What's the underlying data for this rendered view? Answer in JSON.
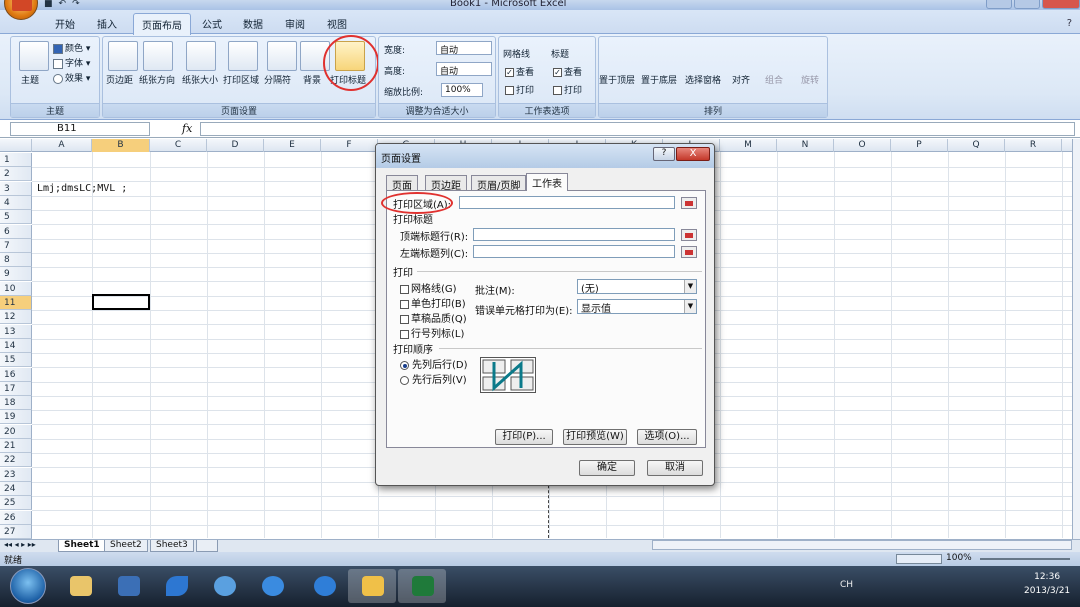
{
  "window": {
    "title": "Book1 - Microsoft Excel",
    "help_icon": "?"
  },
  "tabs": [
    "开始",
    "插入",
    "页面布局",
    "公式",
    "数据",
    "审阅",
    "视图"
  ],
  "ribbon": {
    "theme_group": {
      "label": "主题",
      "themes": "主题",
      "colors": "颜色",
      "fonts": "字体",
      "effects": "效果"
    },
    "page_setup_group": {
      "label": "页面设置",
      "margins": "页边距",
      "orientation": "纸张方向",
      "size": "纸张大小",
      "print_area": "打印区域",
      "breaks": "分隔符",
      "background": "背景",
      "print_titles": "打印标题"
    },
    "scale_group": {
      "label": "调整为合适大小",
      "width": "宽度:",
      "width_value": "自动",
      "height": "高度:",
      "height_value": "自动",
      "scale": "缩放比例:",
      "scale_value": "100%"
    },
    "sheet_options_group": {
      "label": "工作表选项",
      "gridlines": "网格线",
      "headings": "标题",
      "view": "查看",
      "print": "打印"
    },
    "arrange_group": {
      "label": "排列",
      "bring_front": "置于顶层",
      "send_back": "置于底层",
      "selection_pane": "选择窗格",
      "align": "对齐",
      "group": "组合",
      "rotate": "旋转"
    }
  },
  "formula_bar": {
    "name_box": "B11",
    "fx": "fx"
  },
  "columns": [
    "A",
    "B",
    "C",
    "D",
    "E",
    "F",
    "G",
    "H",
    "I",
    "J",
    "K",
    "L",
    "M",
    "N",
    "O",
    "P",
    "Q",
    "R"
  ],
  "rows": [
    "1",
    "2",
    "3",
    "4",
    "5",
    "6",
    "7",
    "8",
    "9",
    "10",
    "11",
    "12",
    "13",
    "14",
    "15",
    "16",
    "17",
    "18",
    "19",
    "20",
    "21",
    "22",
    "23",
    "24",
    "25",
    "26",
    "27"
  ],
  "cells": {
    "A3": "Lmj;dmsLC;MVL ;"
  },
  "sheets": [
    "Sheet1",
    "Sheet2",
    "Sheet3"
  ],
  "status": {
    "ready": "就绪",
    "zoom": "100%"
  },
  "dialog": {
    "title": "页面设置",
    "help": "?",
    "close": "X",
    "tabs": [
      "页面",
      "页边距",
      "页眉/页脚",
      "工作表"
    ],
    "print_area_label": "打印区域(A):",
    "print_titles_label": "打印标题",
    "rows_to_repeat": "顶端标题行(R):",
    "cols_to_repeat": "左端标题列(C):",
    "print_label": "打印",
    "gridlines": "网格线(G)",
    "black_white": "单色打印(B)",
    "draft": "草稿品质(Q)",
    "row_col_headings": "行号列标(L)",
    "comments_label": "批注(M):",
    "comments_value": "(无)",
    "errors_label": "错误单元格打印为(E):",
    "errors_value": "显示值",
    "page_order_label": "打印顺序",
    "down_then_over": "先列后行(D)",
    "over_then_down": "先行后列(V)",
    "print_btn": "打印(P)...",
    "preview_btn": "打印预览(W)",
    "options_btn": "选项(O)...",
    "ok_btn": "确定",
    "cancel_btn": "取消"
  },
  "taskbar": {
    "lang": "CH",
    "time": "12:36",
    "date": "2013/3/21"
  },
  "colors": {
    "highlight": "#e0312f",
    "active_header": "#f6cf7c"
  }
}
